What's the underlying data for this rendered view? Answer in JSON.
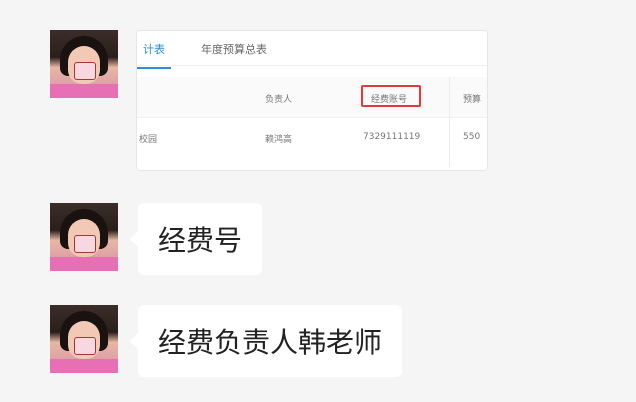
{
  "messages": [
    {
      "type": "image",
      "screenshot": {
        "tabs": [
          "计表",
          "年度预算总表"
        ],
        "columns": [
          "负责人",
          "经费账号",
          "预算"
        ],
        "row": [
          "校园",
          "赖鸿高",
          "7329111119",
          "550"
        ]
      }
    },
    {
      "type": "text",
      "text": "经费号"
    },
    {
      "type": "text",
      "text": "经费负责人韩老师"
    }
  ]
}
